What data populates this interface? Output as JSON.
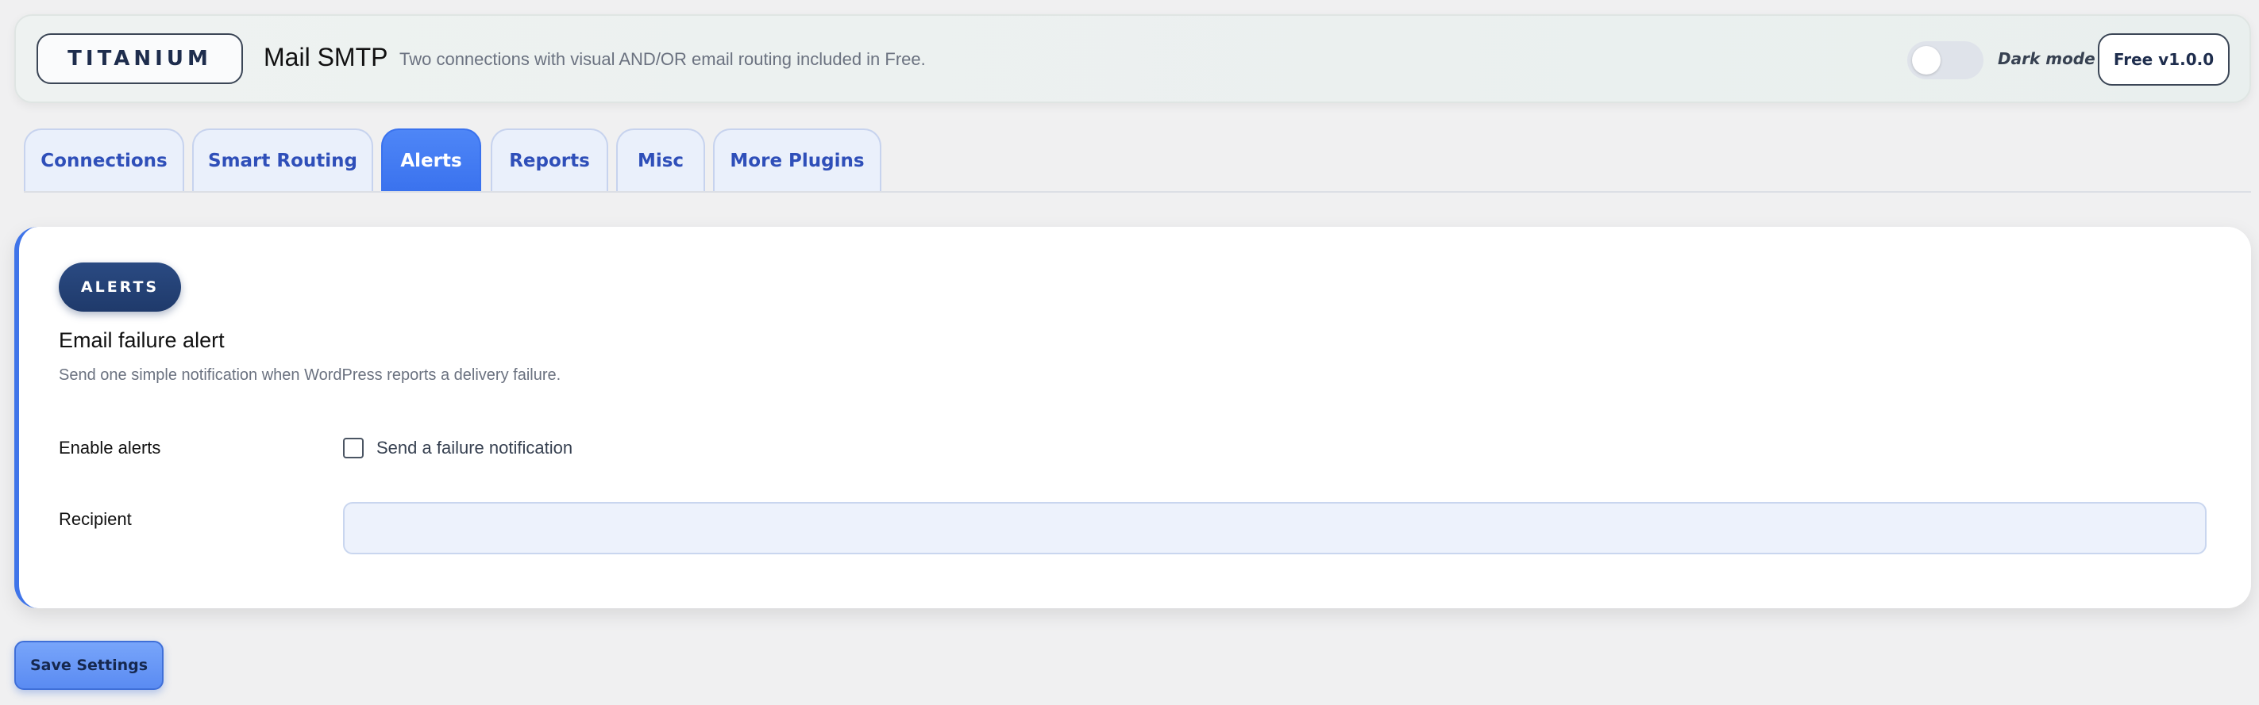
{
  "header": {
    "brand": "TITANIUM",
    "title": "Mail SMTP",
    "subtitle": "Two connections with visual AND/OR email routing included in Free.",
    "dark_mode_label": "Dark mode",
    "dark_mode_on": false,
    "version": "Free v1.0.0"
  },
  "tabs": [
    {
      "label": "Connections",
      "active": false
    },
    {
      "label": "Smart Routing",
      "active": false
    },
    {
      "label": "Alerts",
      "active": true
    },
    {
      "label": "Reports",
      "active": false
    },
    {
      "label": "Misc",
      "active": false
    },
    {
      "label": "More Plugins",
      "active": false
    }
  ],
  "card": {
    "pill": "ALERTS",
    "title": "Email failure alert",
    "description": "Send one simple notification when WordPress reports a delivery failure.",
    "enable_label": "Enable alerts",
    "checkbox_label": "Send a failure notification",
    "checkbox_checked": false,
    "recipient_label": "Recipient",
    "recipient_value": ""
  },
  "save_label": "Save Settings",
  "colors": {
    "accent": "#3f74e9",
    "tab_text": "#2f4fb9",
    "pill_bg": "#1f3a6b"
  }
}
